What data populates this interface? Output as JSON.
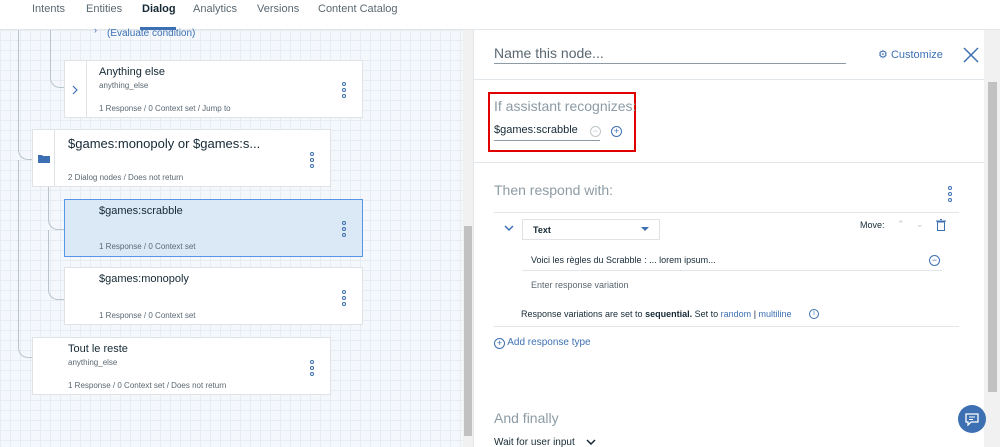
{
  "nav": {
    "tabs": [
      "Intents",
      "Entities",
      "Dialog",
      "Analytics",
      "Versions",
      "Content Catalog"
    ],
    "active": "Dialog"
  },
  "tree": {
    "evaluate_condition": "(Evaluate condition)",
    "nodes": [
      {
        "title": "Anything else",
        "condition": "anything_else",
        "meta": "1 Response / 0 Context set / Jump to"
      },
      {
        "title": "$games:monopoly or $games:s...",
        "condition": "",
        "meta": "2 Dialog nodes / Does not return"
      },
      {
        "title": "$games:scrabble",
        "condition": "",
        "meta": "1 Response / 0 Context set"
      },
      {
        "title": "$games:monopoly",
        "condition": "",
        "meta": "1 Response / 0 Context set"
      },
      {
        "title": "Tout le reste",
        "condition": "anything_else",
        "meta": "1 Response / 0 Context set / Does not return"
      }
    ]
  },
  "panel": {
    "name_placeholder": "Name this node...",
    "customize": "Customize",
    "recognizes_label": "If assistant recognizes:",
    "condition_value": "$games:scrabble",
    "respond_label": "Then respond with:",
    "response_type": "Text",
    "move_label": "Move:",
    "response_text": "Voici les règles du Scrabble : ... lorem ipsum...",
    "variation_placeholder": "Enter response variation",
    "seq_prefix": "Response variations are set to",
    "seq_mode": "sequential.",
    "seq_setto": "Set to",
    "seq_random": "random",
    "seq_sep": "|",
    "seq_multiline": "multiline",
    "add_response": "Add response type",
    "finally_label": "And finally",
    "wait_label": "Wait for user input"
  },
  "colors": {
    "accent": "#3d70b2",
    "highlight": "#e00000",
    "selected_bg": "#dbe9f6"
  }
}
